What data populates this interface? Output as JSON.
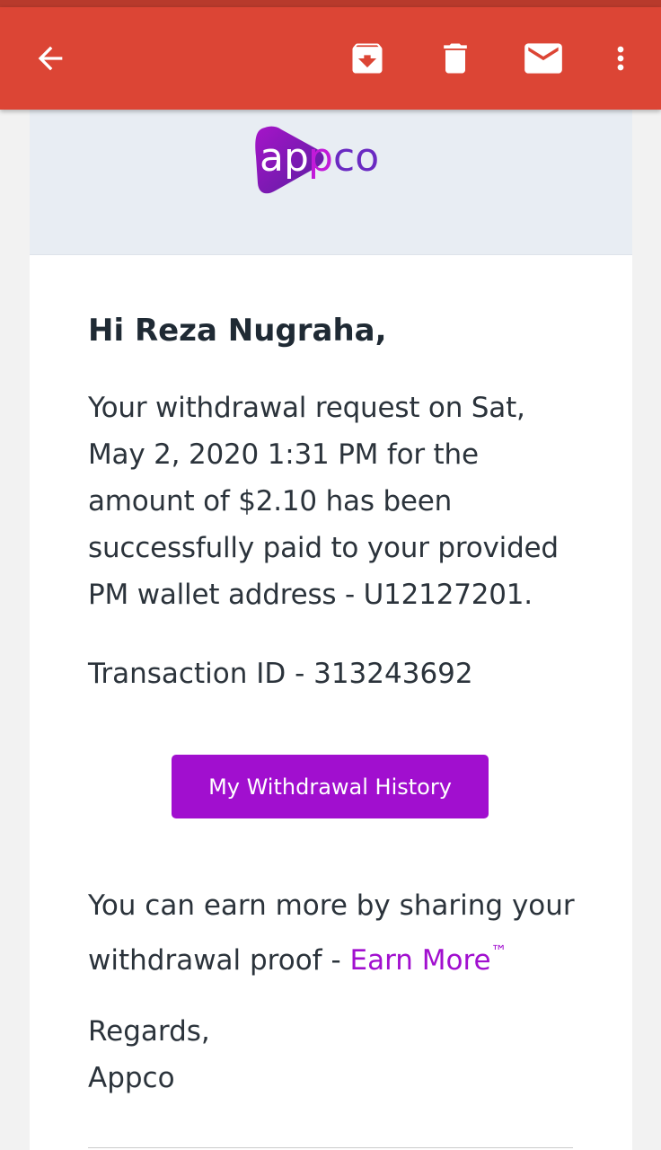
{
  "toolbar": {
    "back_icon": "arrow-back-icon",
    "archive_icon": "archive-icon",
    "delete_icon": "trash-icon",
    "mail_icon": "mail-icon",
    "more_icon": "more-vert-icon",
    "bar_color": "#dc4535"
  },
  "email": {
    "logo_text": "appco",
    "greeting": "Hi Reza Nugraha,",
    "body_lines": [
      "Your withdrawal request on Sat,",
      "May 2, 2020 1:31 PM for the",
      "amount of $2.10 has been",
      "successfully paid to your provided",
      "PM wallet address - U12127201."
    ],
    "transaction": "Transaction ID - 313243692",
    "cta_label": "My Withdrawal History",
    "earn_line1": "You can earn more by sharing your",
    "earn_line2_prefix": "withdrawal proof - ",
    "earn_link": "Earn More",
    "earn_tm": "™",
    "regards": "Regards,",
    "signature": "Appco",
    "accent_color": "#a10fcf"
  }
}
